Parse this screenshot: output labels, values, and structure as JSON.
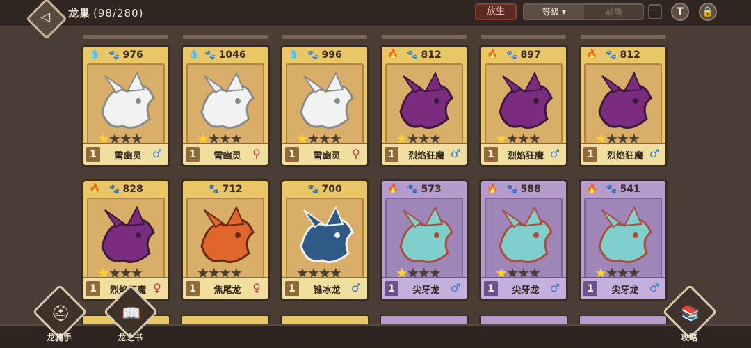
{
  "header": {
    "title": "龙巢",
    "count": "(98/280)",
    "release_label": "放生",
    "sort_level_label": "等级",
    "sort_quality_label": "品质",
    "more_label": "···"
  },
  "cards_row1": [
    {
      "element": "water",
      "power": "976",
      "name": "雪幽灵",
      "level": "1",
      "gender": "♂",
      "stars_lit": 1,
      "rarity": "gold"
    },
    {
      "element": "water",
      "power": "1046",
      "name": "雪幽灵",
      "level": "1",
      "gender": "♀",
      "stars_lit": 1,
      "rarity": "gold"
    },
    {
      "element": "water",
      "power": "996",
      "name": "雪幽灵",
      "level": "1",
      "gender": "♀",
      "stars_lit": 1,
      "rarity": "gold"
    },
    {
      "element": "fire",
      "power": "812",
      "name": "烈焰狂魔",
      "level": "1",
      "gender": "♂",
      "stars_lit": 1,
      "rarity": "gold"
    },
    {
      "element": "fire",
      "power": "897",
      "name": "烈焰狂魔",
      "level": "1",
      "gender": "♂",
      "stars_lit": 1,
      "rarity": "gold"
    },
    {
      "element": "fire",
      "power": "812",
      "name": "烈焰狂魔",
      "level": "1",
      "gender": "♂",
      "stars_lit": 1,
      "rarity": "gold"
    }
  ],
  "cards_row2": [
    {
      "element": "fire",
      "power": "828",
      "name": "烈焰狂魔",
      "level": "1",
      "gender": "♀",
      "stars_lit": 1,
      "rarity": "gold"
    },
    {
      "element": "none",
      "power": "712",
      "name": "焦尾龙",
      "level": "1",
      "gender": "♀",
      "stars_lit": 0,
      "rarity": "gold"
    },
    {
      "element": "none",
      "power": "700",
      "name": "锥冰龙",
      "level": "1",
      "gender": "♂",
      "stars_lit": 0,
      "rarity": "gold"
    },
    {
      "element": "fire",
      "power": "573",
      "name": "尖牙龙",
      "level": "1",
      "gender": "♂",
      "stars_lit": 1,
      "rarity": "purple"
    },
    {
      "element": "fire",
      "power": "588",
      "name": "尖牙龙",
      "level": "1",
      "gender": "♂",
      "stars_lit": 1,
      "rarity": "purple"
    },
    {
      "element": "fire",
      "power": "541",
      "name": "尖牙龙",
      "level": "1",
      "gender": "♂",
      "stars_lit": 1,
      "rarity": "purple"
    }
  ],
  "nav": {
    "rider_label": "龙骑手",
    "book_label": "龙之书",
    "guide_label": "攻略"
  },
  "colors": {
    "male": "#3f78c8",
    "female": "#c9383e",
    "gold_card": "#e9c766",
    "purple_card": "#b59ccc"
  },
  "icons": {
    "water": "water-drop-icon",
    "fire": "fire-icon",
    "power": "paw-icon"
  }
}
